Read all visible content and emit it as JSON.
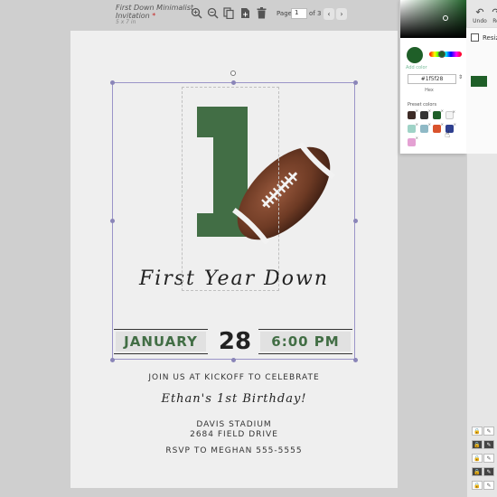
{
  "doc": {
    "title_line1": "First Down Minimalist",
    "title_line2": "Invitation",
    "unsaved_marker": "*",
    "size": "5 x 7 in"
  },
  "toolbar": {
    "page_label": "Page",
    "page_value": "1",
    "page_of": "of 3",
    "icons": [
      "zoom-in-icon",
      "zoom-out-icon",
      "copy-icon",
      "add-page-icon",
      "trash-icon"
    ],
    "prev_glyph": "‹",
    "next_glyph": "›"
  },
  "invite": {
    "script_title": "First Year Down",
    "month": "JANUARY",
    "day": "28",
    "time": "6:00 PM",
    "join_line": "JOIN US AT KICKOFF TO CELEBRATE",
    "birthday_script": "Ethan's 1st Birthday!",
    "venue": "DAVIS STADIUM",
    "address": "2684 FIELD DRIVE",
    "rsvp": "RSVP TO  MEGHAN 555-5555"
  },
  "color_panel": {
    "current_hex": "#1f5f28",
    "add_color_label": "Add color",
    "hex_caption": "Hex",
    "preset_label": "Preset colors",
    "presets": [
      "#3d2b26",
      "#333333",
      "#1f5f28",
      "#f4f4f4",
      "#9fd3c7",
      "#8fb9c6",
      "#d9532c",
      "#2e3f8f",
      "#e4a1d3"
    ]
  },
  "right_panel": {
    "undo_label": "Undo",
    "redo_label": "Re",
    "resize_label": "Resiz"
  },
  "colors": {
    "green": "#426e45",
    "accent_selection": "#9a94c8"
  }
}
